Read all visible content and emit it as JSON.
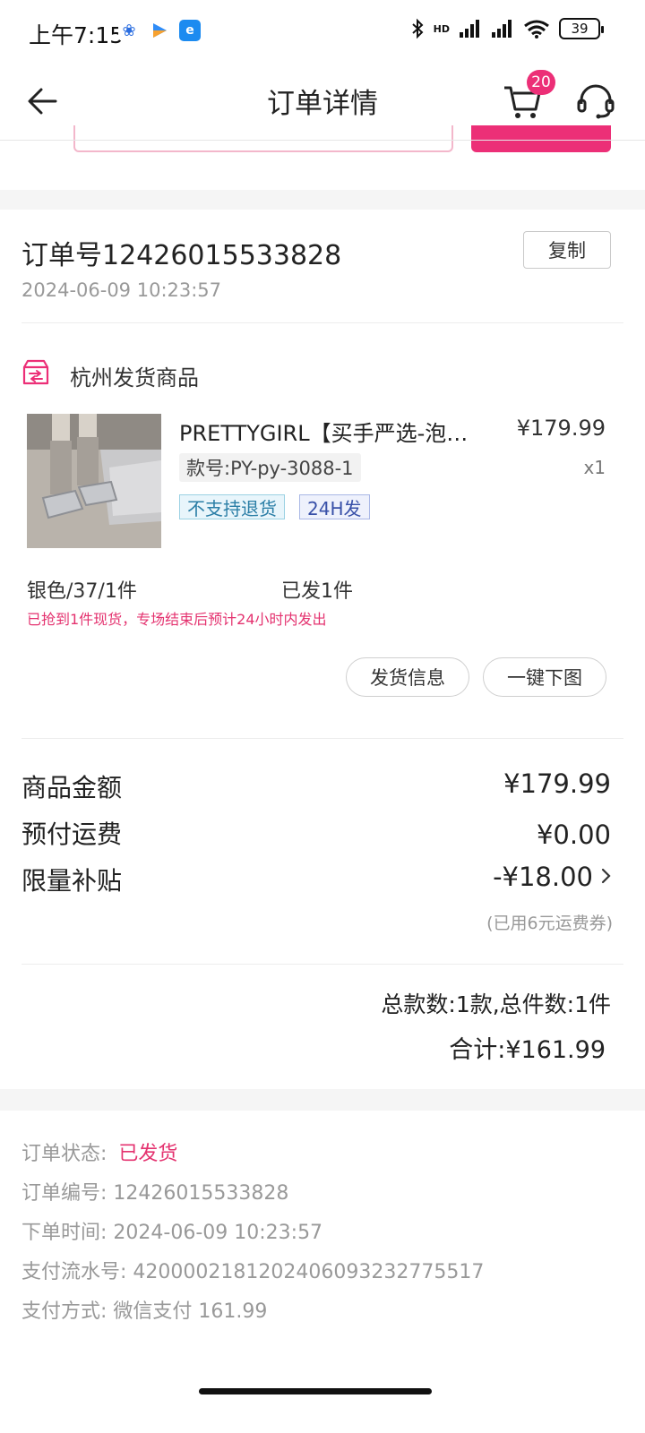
{
  "status_bar": {
    "time": "上午7:15",
    "apps": [
      "paw-app-icon",
      "play-app-icon",
      "browser-app-icon"
    ],
    "network": "HD",
    "battery": "39"
  },
  "header": {
    "title": "订单详情",
    "cart_badge": "20",
    "icons": {
      "back": "back-arrow-icon",
      "cart": "cart-icon",
      "service": "headset-icon"
    }
  },
  "order": {
    "number_line": "订单号12426015533828",
    "time": "2024-06-09 10:23:57",
    "copy_label": "复制"
  },
  "shipment": {
    "title": "杭州发货商品",
    "product": {
      "name": "PRETTYGIRL【买手严选-泡…",
      "price": "¥179.99",
      "style_code": "款号:PY-py-3088-1",
      "quantity": "x1",
      "tags": [
        "不支持退货",
        "24H发"
      ],
      "sku": "银色/37/1件",
      "shipped": "已发1件",
      "notice": "已抢到1件现货，专场结束后预计24小时内发出"
    },
    "buttons": {
      "shipping_info": "发货信息",
      "download_images": "一键下图"
    }
  },
  "fees": [
    {
      "label": "商品金额",
      "value": "¥179.99"
    },
    {
      "label": "预付运费",
      "value": "¥0.00"
    },
    {
      "label": "限量补贴",
      "value": "-¥18.00"
    }
  ],
  "coupon_note": "(已用6元运费券)",
  "summary": {
    "counts": "总款数:1款,总件数:1件",
    "total": "合计:¥161.99"
  },
  "info": {
    "status_label": "订单状态:",
    "status_value": "已发货",
    "order_no": "订单编号: 12426015533828",
    "order_time": "下单时间: 2024-06-09 10:23:57",
    "payment_serial": "支付流水号: 4200002181202406093232775517",
    "payment_method": "支付方式: 微信支付 161.99"
  },
  "colors": {
    "accent": "#ec2f77",
    "muted": "#999999"
  }
}
